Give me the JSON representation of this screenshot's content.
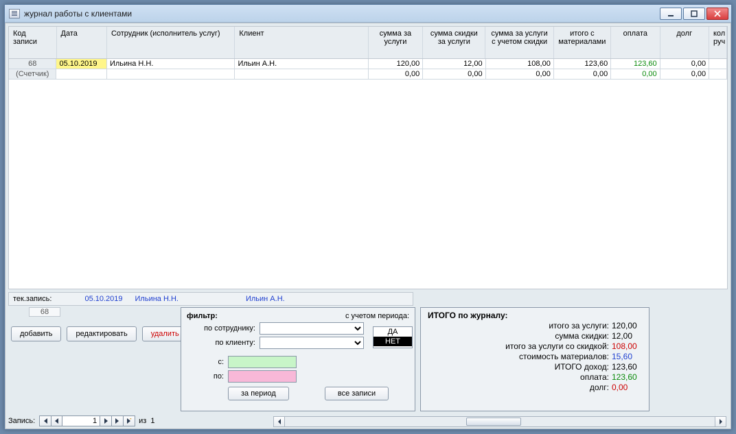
{
  "window": {
    "title": "журнал работы с клиентами"
  },
  "columns": {
    "code": "Код записи",
    "date": "Дата",
    "emp": "Сотрудник (исполнитель услуг)",
    "client": "Клиент",
    "sum1": "сумма за услуги",
    "sum2": "сумма скидки за услуги",
    "sum3": "сумма за услуги с учетом скидки",
    "itog": "итого с материалами",
    "opl": "оплата",
    "dolg": "долг",
    "last": "кол руч"
  },
  "rows": [
    {
      "code": "68",
      "date": "05.10.2019",
      "emp": "Ильина Н.Н.",
      "client": "Ильин А.Н.",
      "sum1": "120,00",
      "sum2": "12,00",
      "sum3": "108,00",
      "itog": "123,60",
      "opl": "123,60",
      "dolg": "0,00"
    },
    {
      "code": "(Счетчик)",
      "date": "",
      "emp": "",
      "client": "",
      "sum1": "0,00",
      "sum2": "0,00",
      "sum3": "0,00",
      "itog": "0,00",
      "opl": "0,00",
      "dolg": "0,00"
    }
  ],
  "current": {
    "label": "тек.запись:",
    "date": "05.10.2019",
    "emp": "Ильина Н.Н.",
    "client": "Ильин А.Н.",
    "id": "68"
  },
  "actions": {
    "add": "добавить",
    "edit": "редактировать",
    "del": "удалить"
  },
  "filter": {
    "title": "фильтр:",
    "period_label": "с учетом периода:",
    "by_emp": "по сотруднику:",
    "by_client": "по клиенту:",
    "from": "с:",
    "to": "по:",
    "period_btn": "за период",
    "all_btn": "все записи",
    "period_options": {
      "yes": "ДА",
      "no": "НЕТ"
    }
  },
  "totals": {
    "title": "ИТОГО по журналу:",
    "rows": [
      {
        "lab": "итого за услуги:",
        "val": "120,00",
        "cls": ""
      },
      {
        "lab": "сумма скидки:",
        "val": "12,00",
        "cls": ""
      },
      {
        "lab": "итого за услуги со скидкой:",
        "val": "108,00",
        "cls": "red"
      },
      {
        "lab": "стоимость материалов:",
        "val": "15,60",
        "cls": "blue"
      },
      {
        "lab": "ИТОГО доход:",
        "val": "123,60",
        "cls": ""
      },
      {
        "lab": "оплата:",
        "val": "123,60",
        "cls": "green"
      },
      {
        "lab": "долг:",
        "val": "0,00",
        "cls": "red"
      }
    ]
  },
  "nav": {
    "label": "Запись:",
    "pos": "1",
    "of_label": "из",
    "of": "1"
  }
}
